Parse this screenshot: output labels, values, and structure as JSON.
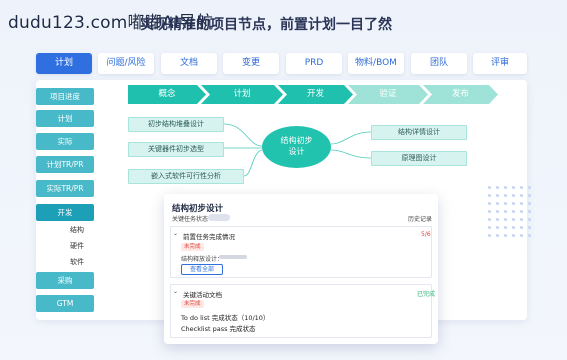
{
  "watermark": "dudu123.com嘟嘟AI导航",
  "heading": "实现精准的项目节点，前置计划一目了然",
  "tabs": [
    "计划",
    "问题/风险",
    "文档",
    "变更",
    "PRD",
    "物料/BOM",
    "团队",
    "评审"
  ],
  "active_tab": 0,
  "sidebar": {
    "items": [
      "项目进度",
      "计划",
      "实际",
      "计划TR/PR",
      "实际TR/PR",
      "开发",
      "采购",
      "GTM"
    ],
    "active": "开发",
    "sub_items": [
      "结构",
      "硬件",
      "软件"
    ]
  },
  "flow_steps": [
    {
      "label": "概念",
      "color": "#1fc0ad"
    },
    {
      "label": "计划",
      "color": "#1fc0ad"
    },
    {
      "label": "开发",
      "color": "#1fc0ad"
    },
    {
      "label": "验证",
      "color": "#9fe3d8"
    },
    {
      "label": "发布",
      "color": "#9fe3d8"
    }
  ],
  "mindmap": {
    "center": "结构初步设计",
    "left_nodes": [
      "初步结构堆叠设计",
      "关键器件初步选型",
      "嵌入式软件可行性分析"
    ],
    "right_nodes": [
      "结构详情设计",
      "原理图设计"
    ]
  },
  "card": {
    "title": "结构初步设计",
    "status_label": "关键任务状态",
    "history_link": "历史记录",
    "section1": {
      "title": "前置任务完成情况",
      "count": "5/6",
      "tag": "未完成",
      "line": "结构释放设计：",
      "button": "查看全部"
    },
    "section2": {
      "title": "关键活动文档",
      "status": "已完成",
      "tag": "未完成",
      "line1": "To do list 完成状态（10/10）",
      "line2": "Checklist pass 完成状态"
    }
  },
  "colors": {
    "primary": "#2f6fe0",
    "sidebar": "#48b9c9",
    "flow_active": "#1fc0ad",
    "flow_inactive": "#9fe3d8",
    "node_bg": "#d7f3ef",
    "danger": "#e0453a",
    "success": "#2bb673"
  }
}
